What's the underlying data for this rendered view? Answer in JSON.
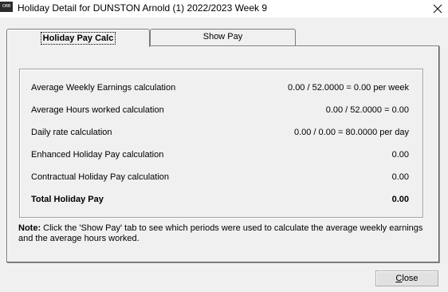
{
  "window": {
    "title": "Holiday Detail for DUNSTON Arnold (1) 2022/2023 Week 9",
    "app_icon_text": "ORB"
  },
  "tabs": [
    {
      "label": "Holiday Pay Calc",
      "active": true
    },
    {
      "label": "Show Pay",
      "active": false
    }
  ],
  "calculations": [
    {
      "label": "Average Weekly Earnings calculation",
      "value": "0.00 / 52.0000 = 0.00 per week"
    },
    {
      "label": "Average Hours worked calculation",
      "value": "0.00 / 52.0000 = 0.00"
    },
    {
      "label": "Daily rate calculation",
      "value": "0.00 / 0.00 = 80.0000 per day"
    },
    {
      "label": "Enhanced Holiday Pay calculation",
      "value": "0.00"
    },
    {
      "label": "Contractual Holiday Pay calculation",
      "value": "0.00"
    },
    {
      "label": "Total Holiday Pay",
      "value": "0.00"
    }
  ],
  "note": {
    "prefix": "Note:",
    "text": " Click the 'Show Pay' tab to see which periods were used to calculate the average weekly earnings and the average hours worked."
  },
  "buttons": {
    "close_label": "Close"
  }
}
